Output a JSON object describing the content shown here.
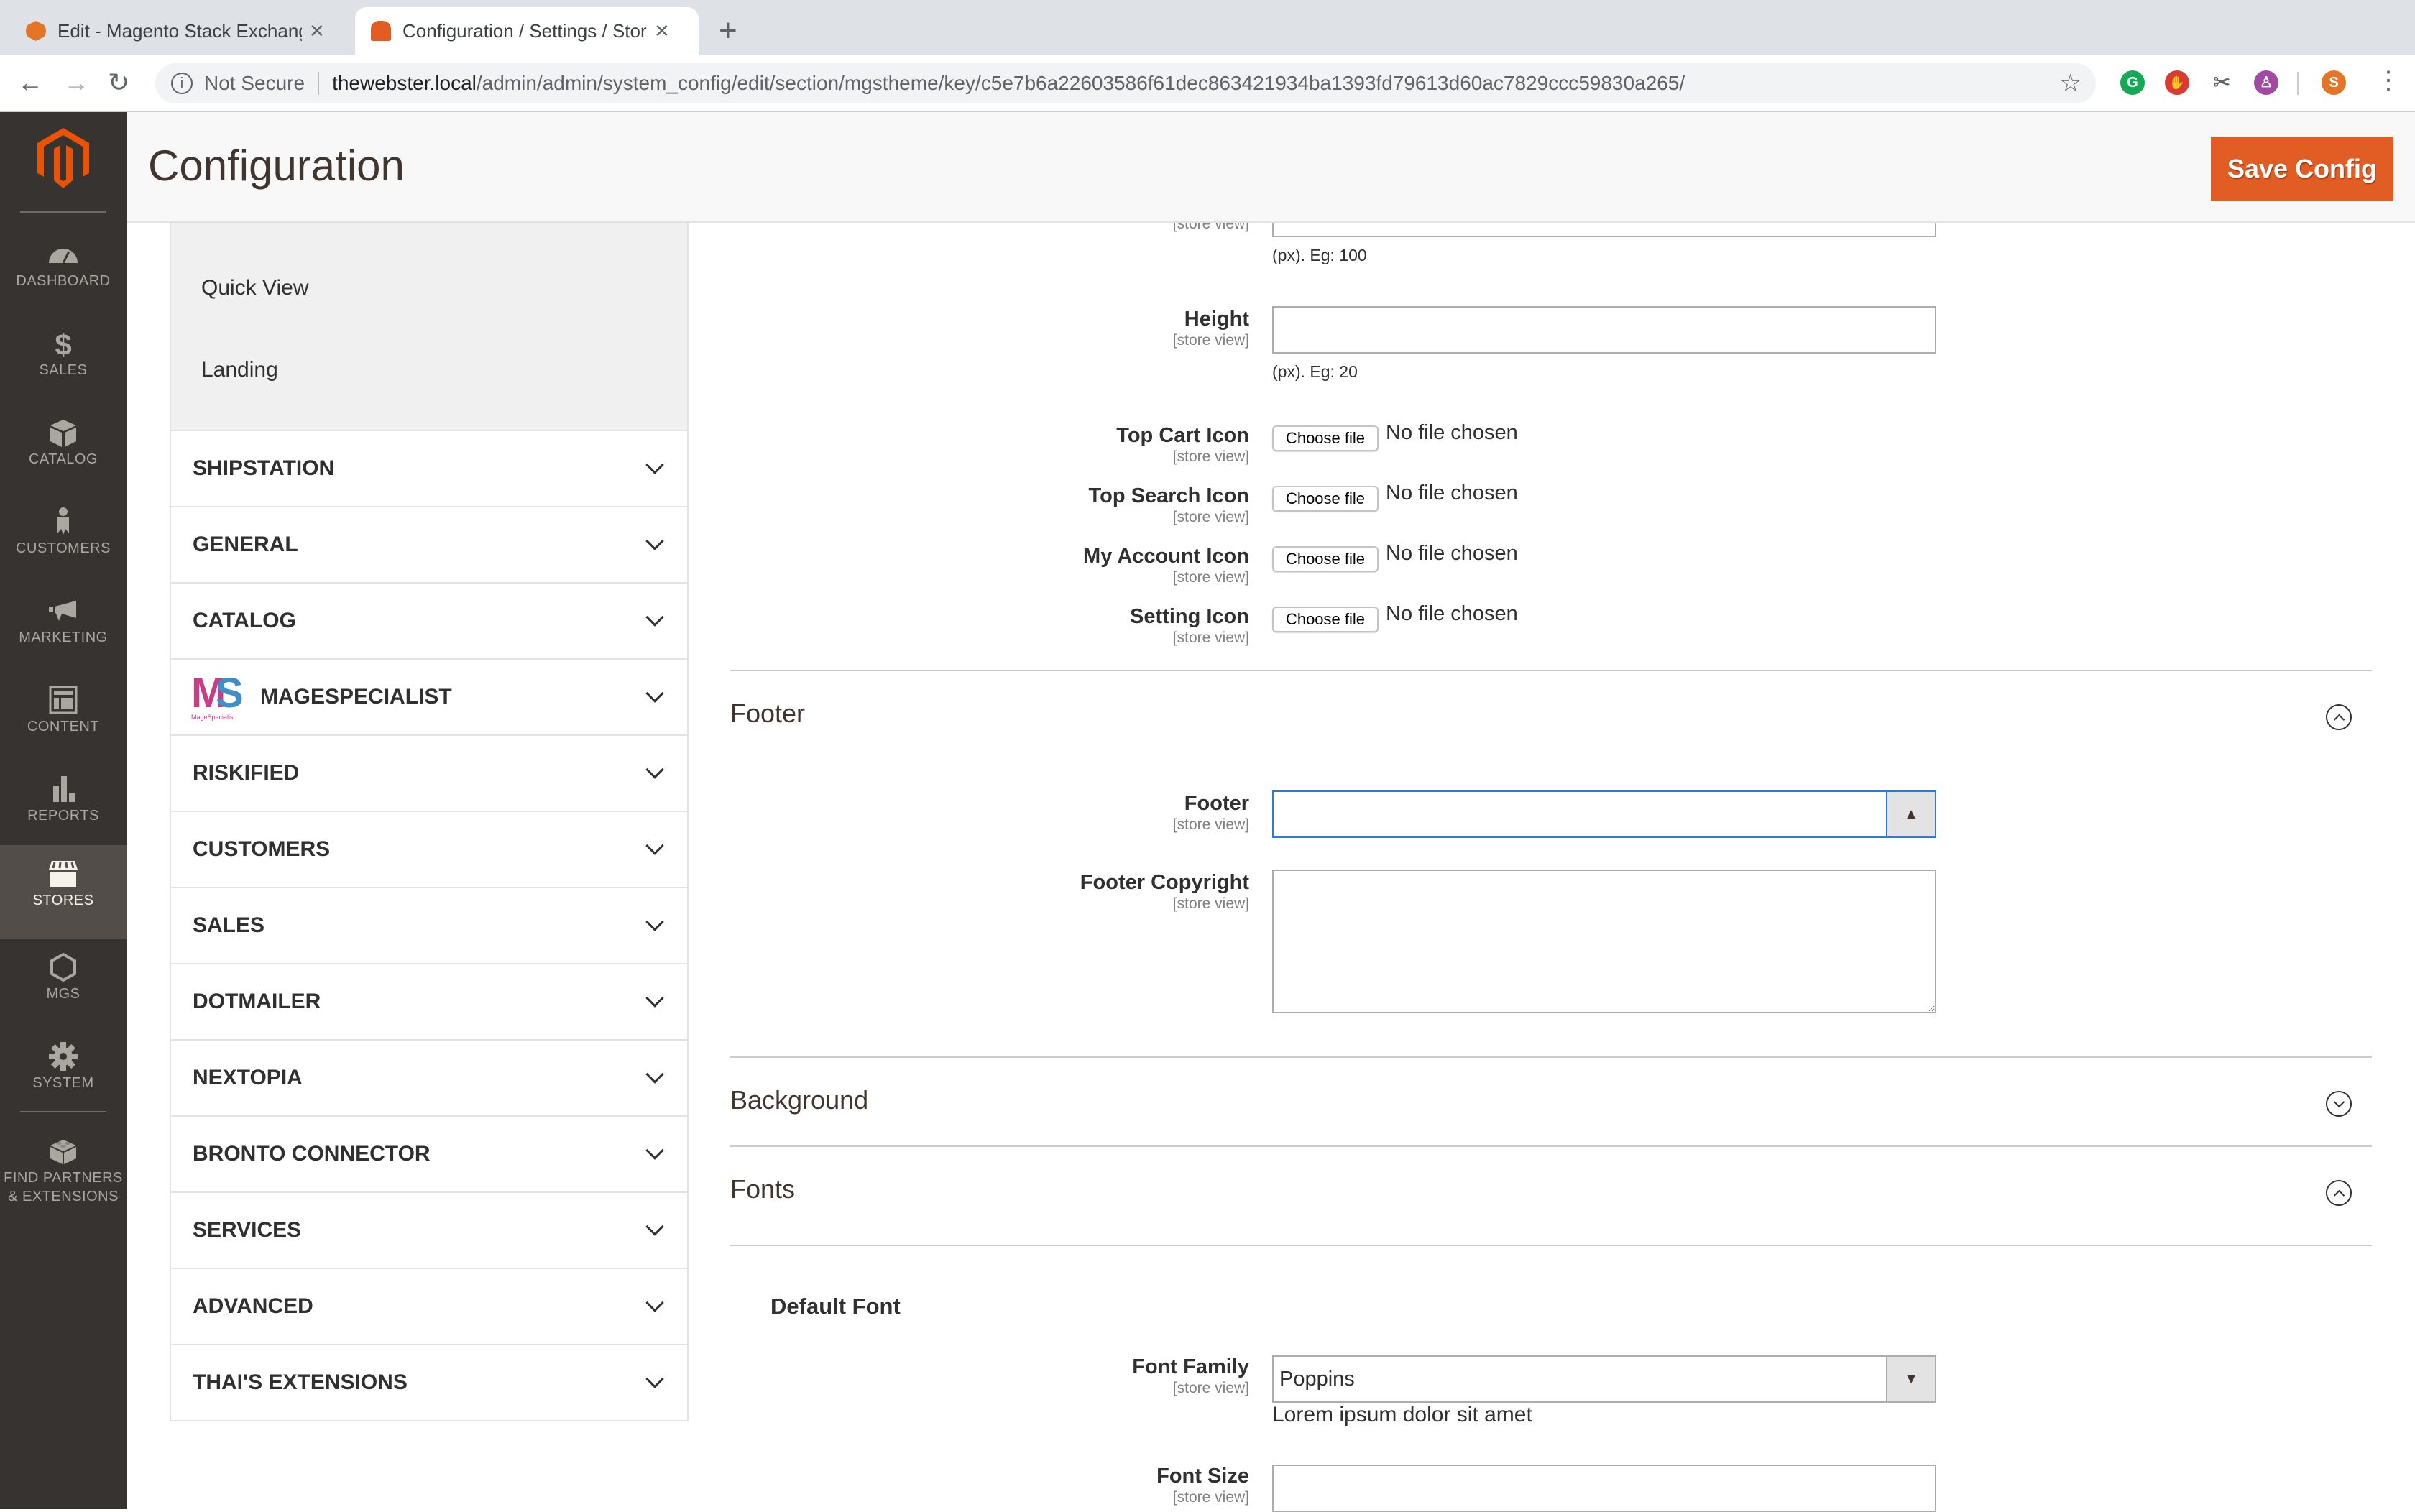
{
  "browser": {
    "tabs": [
      {
        "title": "Edit - Magento Stack Exchange",
        "active": false,
        "favicon": "stackexchange-magento-icon"
      },
      {
        "title": "Configuration / Settings / Stores",
        "active": true,
        "favicon": "magento-icon"
      }
    ],
    "close_glyph": "✕",
    "new_tab_glyph": "+",
    "security_label": "Not Secure",
    "url_host": "thewebster.local",
    "url_path": "/admin/admin/system_config/edit/section/mgstheme/key/c5e7b6a22603586f61dec863421934ba1393fd79613d60ac7829ccc59830a265/",
    "extensions": [
      {
        "name": "grammarly-extension",
        "glyph": "G",
        "color": "#15a857"
      },
      {
        "name": "adblock-extension",
        "glyph": "✋",
        "color": "#d93a32"
      },
      {
        "name": "tools-extension",
        "glyph": "✂",
        "color": "#5f6368"
      },
      {
        "name": "profile-extension",
        "glyph": "♙",
        "color": "#a349a4"
      }
    ],
    "profile_initial": "S",
    "profile_color": "#e37526"
  },
  "admin_menu": [
    {
      "label": "DASHBOARD",
      "icon": "dashboard-icon",
      "active": false
    },
    {
      "label": "SALES",
      "icon": "dollar-icon",
      "active": false
    },
    {
      "label": "CATALOG",
      "icon": "box-icon",
      "active": false
    },
    {
      "label": "CUSTOMERS",
      "icon": "person-icon",
      "active": false
    },
    {
      "label": "MARKETING",
      "icon": "megaphone-icon",
      "active": false
    },
    {
      "label": "CONTENT",
      "icon": "layout-icon",
      "active": false
    },
    {
      "label": "REPORTS",
      "icon": "bar-chart-icon",
      "active": false
    },
    {
      "label": "STORES",
      "icon": "storefront-icon",
      "active": true
    },
    {
      "label": "MGS",
      "icon": "hexagon-icon",
      "active": false
    },
    {
      "label": "SYSTEM",
      "icon": "gear-icon",
      "active": false
    },
    {
      "label": "FIND PARTNERS & EXTENSIONS",
      "icon": "lego-block-icon",
      "active": false
    }
  ],
  "header": {
    "title": "Configuration",
    "save_label": "Save Config",
    "accent": "#e15d24"
  },
  "config_nav": {
    "sub_items": [
      "Quick View",
      "Landing"
    ],
    "sections": [
      {
        "label": "SHIPSTATION"
      },
      {
        "label": "GENERAL"
      },
      {
        "label": "CATALOG"
      },
      {
        "label": "MAGESPECIALIST",
        "logo": "MS",
        "logo_sub": "MageSpecialist"
      },
      {
        "label": "RISKIFIED"
      },
      {
        "label": "CUSTOMERS"
      },
      {
        "label": "SALES"
      },
      {
        "label": "DOTMAILER"
      },
      {
        "label": "NEXTOPIA"
      },
      {
        "label": "BRONTO CONNECTOR"
      },
      {
        "label": "SERVICES"
      },
      {
        "label": "ADVANCED"
      },
      {
        "label": "THAI'S EXTENSIONS"
      }
    ]
  },
  "form": {
    "scope": "[store view]",
    "width_note": "(px). Eg: 100",
    "height": {
      "label": "Height",
      "value": "",
      "note": "(px). Eg: 20"
    },
    "file_fields": [
      {
        "label": "Top Cart Icon"
      },
      {
        "label": "Top Search Icon"
      },
      {
        "label": "My Account Icon"
      },
      {
        "label": "Setting Icon"
      }
    ],
    "choose_file_label": "Choose file",
    "no_file_label": "No file chosen",
    "footer_section": {
      "title": "Footer",
      "expanded": true,
      "footer_label": "Footer",
      "footer_value": "",
      "copyright_label": "Footer Copyright",
      "copyright_value": ""
    },
    "background_section": {
      "title": "Background",
      "expanded": false
    },
    "fonts_section": {
      "title": "Fonts",
      "expanded": true,
      "subheading": "Default Font",
      "font_family_label": "Font Family",
      "font_family_value": "Poppins",
      "preview_text": "Lorem ipsum dolor sit amet",
      "font_size_label": "Font Size",
      "font_size_value": ""
    }
  }
}
